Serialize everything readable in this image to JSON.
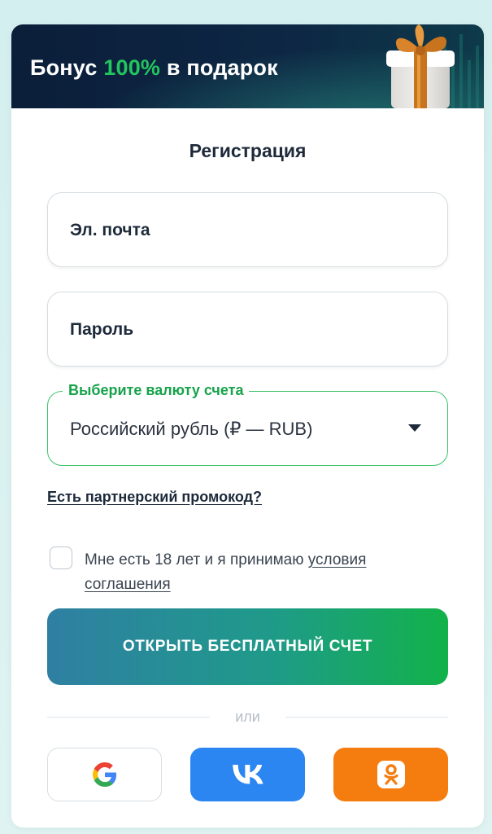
{
  "banner": {
    "title_prefix": "Бонус",
    "title_accent": "100%",
    "title_suffix": "в подарок",
    "accent_color": "#22c55e",
    "gift_icon": "gift-box-icon"
  },
  "form": {
    "title": "Регистрация",
    "email_placeholder": "Эл. почта",
    "password_placeholder": "Пароль",
    "currency_label": "Выберите валюту счета",
    "currency_value": "Российский рубль (₽ — RUB)",
    "promo_link": "Есть партнерский промокод?",
    "terms_text": "Мне есть 18 лет и я принимаю",
    "terms_link": "условия соглашения",
    "submit_label": "ОТКРЫТЬ БЕСПЛАТНЫЙ СЧЕТ",
    "divider_text": "или"
  },
  "social": {
    "google_icon": "google-icon",
    "vk_icon": "vk-icon",
    "ok_icon": "odnoklassniki-icon",
    "vk_color": "#2b86f2",
    "ok_color": "#f57d10"
  },
  "colors": {
    "primary_green": "#16a34a",
    "text_dark": "#1e2a3a",
    "banner_bg": "#0b1e3a"
  }
}
